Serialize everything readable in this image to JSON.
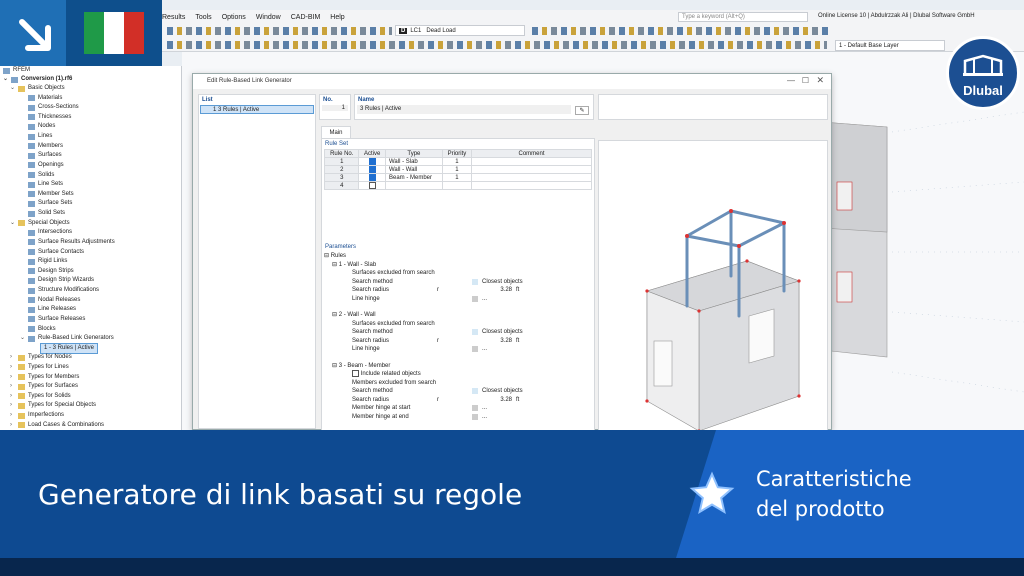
{
  "menu": [
    "Results",
    "Tools",
    "Options",
    "Window",
    "CAD-BIM",
    "Help"
  ],
  "search_placeholder": "Type a keyword (Alt+Q)",
  "license_text": "Online License 10 | Abdulrzzak Ali | Dlubal Software GmbH",
  "load_case": {
    "code": "D",
    "id": "LC1",
    "name": "Dead Load"
  },
  "base_layer": "1 - Default Base Layer",
  "logo_text": "Dlubal",
  "navigator": {
    "root": "RFEM",
    "file": "Conversion (1).rf6",
    "items": [
      {
        "label": "Basic Objects",
        "level": 1,
        "folder": true,
        "expanded": true
      },
      {
        "label": "Materials",
        "level": 2
      },
      {
        "label": "Cross-Sections",
        "level": 2
      },
      {
        "label": "Thicknesses",
        "level": 2
      },
      {
        "label": "Nodes",
        "level": 2
      },
      {
        "label": "Lines",
        "level": 2
      },
      {
        "label": "Members",
        "level": 2
      },
      {
        "label": "Surfaces",
        "level": 2
      },
      {
        "label": "Openings",
        "level": 2
      },
      {
        "label": "Solids",
        "level": 2
      },
      {
        "label": "Line Sets",
        "level": 2
      },
      {
        "label": "Member Sets",
        "level": 2
      },
      {
        "label": "Surface Sets",
        "level": 2
      },
      {
        "label": "Solid Sets",
        "level": 2
      },
      {
        "label": "Special Objects",
        "level": 1,
        "folder": true,
        "expanded": true
      },
      {
        "label": "Intersections",
        "level": 2
      },
      {
        "label": "Surface Results Adjustments",
        "level": 2
      },
      {
        "label": "Surface Contacts",
        "level": 2
      },
      {
        "label": "Rigid Links",
        "level": 2
      },
      {
        "label": "Design Strips",
        "level": 2
      },
      {
        "label": "Design Strip Wizards",
        "level": 2
      },
      {
        "label": "Structure Modifications",
        "level": 2
      },
      {
        "label": "Nodal Releases",
        "level": 2
      },
      {
        "label": "Line Releases",
        "level": 2
      },
      {
        "label": "Surface Releases",
        "level": 2
      },
      {
        "label": "Blocks",
        "level": 2
      },
      {
        "label": "Rule-Based Link Generators",
        "level": 2,
        "expanded": true
      },
      {
        "label": "1 - 3 Rules | Active",
        "level": 3,
        "selected": true
      },
      {
        "label": "Types for Nodes",
        "level": 1,
        "folder": true
      },
      {
        "label": "Types for Lines",
        "level": 1,
        "folder": true
      },
      {
        "label": "Types for Members",
        "level": 1,
        "folder": true
      },
      {
        "label": "Types for Surfaces",
        "level": 1,
        "folder": true
      },
      {
        "label": "Types for Solids",
        "level": 1,
        "folder": true
      },
      {
        "label": "Types for Special Objects",
        "level": 1,
        "folder": true
      },
      {
        "label": "Imperfections",
        "level": 1,
        "folder": true
      },
      {
        "label": "Load Cases & Combinations",
        "level": 1,
        "folder": true
      }
    ]
  },
  "dialog": {
    "title": "Edit Rule-Based Link Generator",
    "list_header": "List",
    "list_item": "1  3 Rules | Active",
    "no_header": "No.",
    "no_value": "1",
    "name_header": "Name",
    "name_value": "3 Rules | Active",
    "tab": "Main",
    "rule_set_header": "Rule Set",
    "rule_columns": [
      "Rule No.",
      "Active",
      "Type",
      "Priority",
      "Comment"
    ],
    "rules": [
      {
        "no": "1",
        "active": true,
        "type": "Wall - Slab",
        "priority": "1"
      },
      {
        "no": "2",
        "active": true,
        "type": "Wall - Wall",
        "priority": "1"
      },
      {
        "no": "3",
        "active": true,
        "type": "Beam - Member",
        "priority": "1"
      },
      {
        "no": "4",
        "active": false,
        "type": "",
        "priority": ""
      }
    ],
    "parameters_header": "Parameters",
    "rules_label": "Rules",
    "groups": [
      {
        "title": "1 - Wall - Slab",
        "rows": [
          {
            "label": "Surfaces excluded from search",
            "sym": "",
            "value": "",
            "unit": ""
          },
          {
            "label": "Search method",
            "sym": "",
            "value": "Closest objects",
            "unit": ""
          },
          {
            "label": "Search radius",
            "sym": "r",
            "value": "3.28",
            "unit": "ft"
          },
          {
            "label": "Line hinge",
            "sym": "",
            "value": "...",
            "unit": ""
          }
        ]
      },
      {
        "title": "2 - Wall - Wall",
        "rows": [
          {
            "label": "Surfaces excluded from search",
            "sym": "",
            "value": "",
            "unit": ""
          },
          {
            "label": "Search method",
            "sym": "",
            "value": "Closest objects",
            "unit": ""
          },
          {
            "label": "Search radius",
            "sym": "r",
            "value": "3.28",
            "unit": "ft"
          },
          {
            "label": "Line hinge",
            "sym": "",
            "value": "...",
            "unit": ""
          }
        ]
      },
      {
        "title": "3 - Beam - Member",
        "rows": [
          {
            "label": "Include related objects",
            "sym": "",
            "value": "",
            "unit": "",
            "checkbox": true
          },
          {
            "label": "Members excluded from search",
            "sym": "",
            "value": "",
            "unit": ""
          },
          {
            "label": "Search method",
            "sym": "",
            "value": "Closest objects",
            "unit": ""
          },
          {
            "label": "Search radius",
            "sym": "r",
            "value": "3.28",
            "unit": "ft"
          },
          {
            "label": "Member hinge at start",
            "sym": "",
            "value": "...",
            "unit": ""
          },
          {
            "label": "Member hinge at end",
            "sym": "",
            "value": "...",
            "unit": ""
          }
        ]
      }
    ]
  },
  "banner": {
    "title": "Generatore di link basati su regole",
    "subtitle_line1": "Caratteristiche",
    "subtitle_line2": "del prodotto"
  },
  "colors": {
    "accent": "#1c4f92",
    "banner": "#0e4a91",
    "banner_light": "#1a63c4",
    "flag_green": "#1f9a48",
    "flag_red": "#d22f27"
  }
}
